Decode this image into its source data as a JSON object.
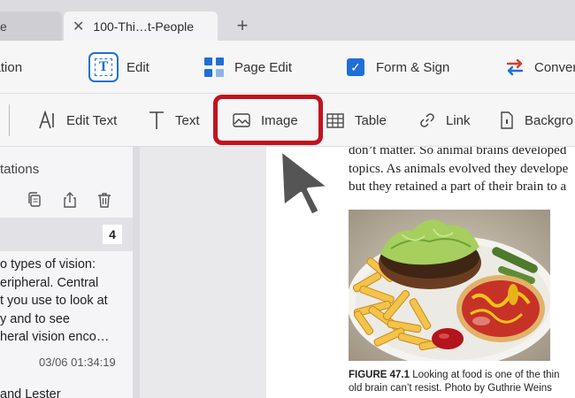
{
  "tabs": [
    {
      "label": "e"
    },
    {
      "label": "100-Thi…t-People",
      "close": "✕"
    }
  ],
  "new_tab": "+",
  "main_toolbar": {
    "annotation": "otation",
    "edit": "Edit",
    "edit_icon_letter": "T",
    "page_edit": "Page Edit",
    "form_sign": "Form & Sign",
    "convert": "Conver",
    "accent": "#1f6fd6",
    "convert_colors": [
      "#d93b30",
      "#1f6fd6"
    ]
  },
  "sub_toolbar": {
    "edit_text": "Edit Text",
    "text": "Text",
    "image": "Image",
    "table": "Table",
    "link": "Link",
    "background": "Backgro",
    "highlight_color": "#c1121f"
  },
  "panel": {
    "title": "tations",
    "count": "4",
    "note_lines": [
      "o types of vision:",
      "eripheral. Central",
      "t you use to look at",
      "y and to see",
      "heral vision enco…"
    ],
    "timestamp": "03/06 01:34:19",
    "next_note": "and Lester"
  },
  "document": {
    "body_lines": [
      "don’t matter. So animal brains developed",
      "topics. As animals evolved they develope",
      "but they retained a part of their brain to a"
    ],
    "figure_label": "FIGURE 47.1",
    "caption_lines": [
      " Looking at food is one of the thin",
      "old brain can’t resist. Photo by Guthrie Weins"
    ]
  }
}
